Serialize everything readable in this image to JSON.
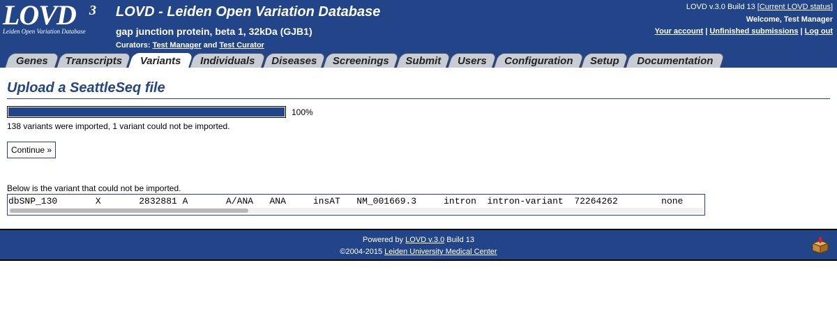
{
  "header": {
    "logo_text": "LOVD",
    "logo_version": "3",
    "logo_subtitle": "Leiden Open Variation Database",
    "site_title": "LOVD - Leiden Open Variation Database",
    "gene_title": "gap junction protein, beta 1, 32kDa (GJB1)",
    "curators_label": "Curators:",
    "curator_1": "Test Manager",
    "curators_and": "and",
    "curator_2": "Test Curator",
    "version_text": "LOVD v.3.0 Build 13 [",
    "version_link": "Current LOVD status",
    "version_close": "]",
    "welcome": "Welcome, Test Manager",
    "link_account": "Your account",
    "link_unfinished": "Unfinished submissions",
    "link_logout": "Log out",
    "link_separator": "|"
  },
  "tabs": [
    {
      "label": "Genes",
      "active": false
    },
    {
      "label": "Transcripts",
      "active": false
    },
    {
      "label": "Variants",
      "active": true
    },
    {
      "label": "Individuals",
      "active": false
    },
    {
      "label": "Diseases",
      "active": false
    },
    {
      "label": "Screenings",
      "active": false
    },
    {
      "label": "Submit",
      "active": false
    },
    {
      "label": "Users",
      "active": false
    },
    {
      "label": "Configuration",
      "active": false
    },
    {
      "label": "Setup",
      "active": false
    },
    {
      "label": "Documentation",
      "active": false
    }
  ],
  "main": {
    "heading": "Upload a SeattleSeq file",
    "progress_percent": 100,
    "progress_label": "100%",
    "import_message": "138 variants were imported, 1 variant could not be imported.",
    "continue_label": "Continue »",
    "failed_caption": "Below is the variant that could not be imported.",
    "failed_variant_line": "dbSNP_130       X       2832881 A       A/ANA   ANA     insAT   NM_001669.3     intron  intron-variant  72264262        none"
  },
  "footer": {
    "powered_prefix": "Powered by",
    "powered_link": "LOVD v.3.0",
    "powered_suffix": "Build 13",
    "copyright_prefix": "©2004-2015",
    "copyright_link": "Leiden University Medical Center"
  },
  "colors": {
    "brand_blue": "#224488",
    "tab_inactive": "#c8ccd4",
    "tab_active": "#ffffff"
  },
  "icons": {
    "footer_icon": "package-box-icon"
  }
}
